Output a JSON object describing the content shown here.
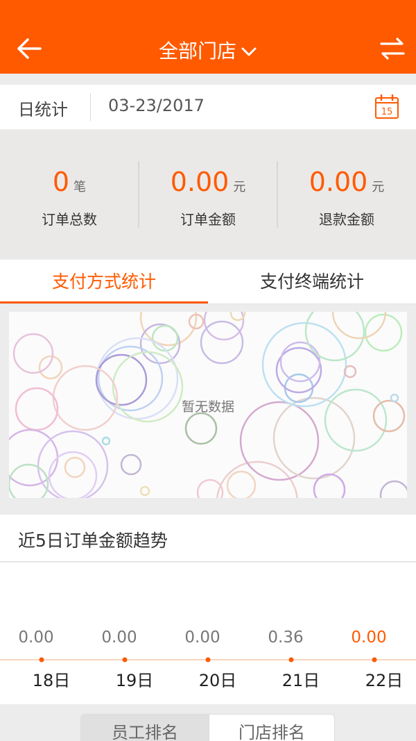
{
  "header": {
    "title": "全部门店",
    "bg_color": "#ff5a00"
  },
  "datebar": {
    "mode": "日统计",
    "date": "03-23/2017",
    "calendar_day": "15"
  },
  "stats": [
    {
      "value": "0",
      "unit": "笔",
      "label": "订单总数"
    },
    {
      "value": "0.00",
      "unit": "元",
      "label": "订单金额"
    },
    {
      "value": "0.00",
      "unit": "元",
      "label": "退款金额"
    }
  ],
  "tabs": [
    {
      "label": "支付方式统计",
      "active": true
    },
    {
      "label": "支付终端统计",
      "active": false
    }
  ],
  "empty": {
    "message": "暂无数据"
  },
  "trend": {
    "title": "近5日订单金额趋势"
  },
  "chart_data": {
    "type": "line",
    "categories": [
      "18日",
      "19日",
      "20日",
      "21日",
      "22日"
    ],
    "values": [
      0.0,
      0.0,
      0.0,
      0.36,
      0.0
    ],
    "value_labels": [
      "0.00",
      "0.00",
      "0.00",
      "0.36",
      "0.00"
    ],
    "highlight_index": 4,
    "accent_color": "#ff5a00"
  },
  "ranking": {
    "employee": "员工排名",
    "store": "门店排名"
  }
}
